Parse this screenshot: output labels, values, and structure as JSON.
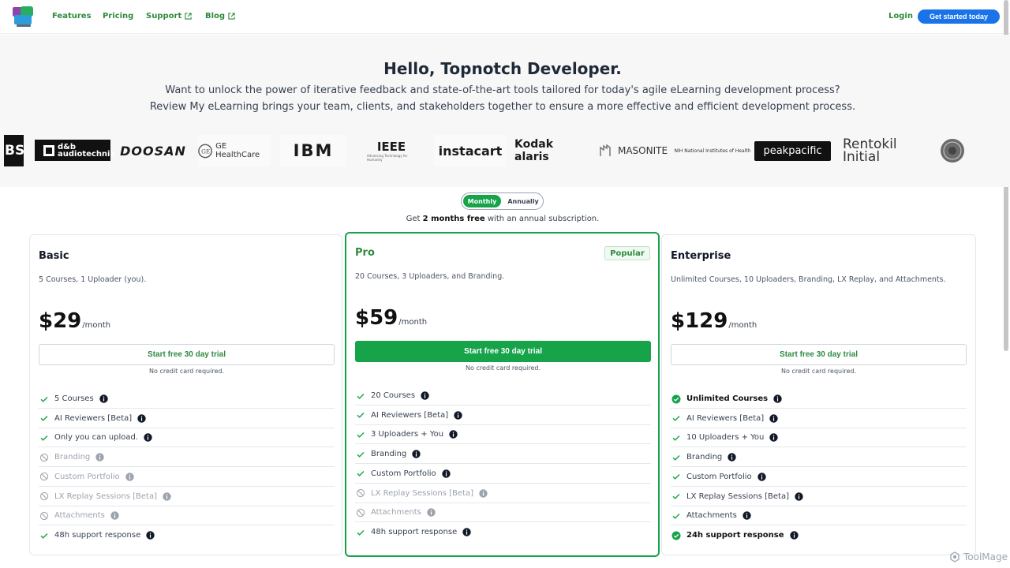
{
  "nav": {
    "links": [
      {
        "label": "Features",
        "external": false
      },
      {
        "label": "Pricing",
        "external": false
      },
      {
        "label": "Support",
        "external": true
      },
      {
        "label": "Blog",
        "external": true
      }
    ],
    "login": "Login",
    "cta": "Get started today",
    "accent": "#2f8a3f",
    "cta_color": "#1a73e8"
  },
  "hero": {
    "title": "Hello, Topnotch Developer.",
    "line1": "Want to unlock the power of iterative feedback and state-of-the-art tools tailored for today's agile eLearning development process?",
    "line2": "Review My eLearning brings your team, clients, and stakeholders together to ensure a more effective and efficient development process."
  },
  "logos": [
    "BS",
    "d&b audiotechnik",
    "DOOSAN",
    "GE HealthCare",
    "IBM",
    "IEEE",
    "instacart",
    "Kodak alaris",
    "MASONITE",
    "NIH National Institutes of Health",
    "peakpacific",
    "Rentokil Initial"
  ],
  "billing": {
    "monthly": "Monthly",
    "annually": "Annually",
    "promo_prefix": "Get ",
    "promo_bold": "2 months free",
    "promo_suffix": " with an annual subscription."
  },
  "plans": [
    {
      "name": "Basic",
      "desc": "5 Courses, 1 Uploader (you).",
      "price": "$29",
      "per": "/month",
      "cta": "Start free 30 day trial",
      "note": "No credit card required.",
      "features": [
        {
          "label": "5 Courses",
          "status": "check"
        },
        {
          "label": "AI Reviewers [Beta]",
          "status": "check"
        },
        {
          "label": "Only you can upload.",
          "status": "check"
        },
        {
          "label": "Branding",
          "status": "off"
        },
        {
          "label": "Custom Portfolio",
          "status": "off"
        },
        {
          "label": "LX Replay Sessions [Beta]",
          "status": "off"
        },
        {
          "label": "Attachments",
          "status": "off"
        },
        {
          "label": "48h support response",
          "status": "check"
        }
      ]
    },
    {
      "name": "Pro",
      "badge": "Popular",
      "desc": "20 Courses, 3 Uploaders, and Branding.",
      "price": "$59",
      "per": "/month",
      "cta": "Start free 30 day trial",
      "note": "No credit card required.",
      "features": [
        {
          "label": "20 Courses",
          "status": "check"
        },
        {
          "label": "AI Reviewers [Beta]",
          "status": "check"
        },
        {
          "label": "3 Uploaders + You",
          "status": "check"
        },
        {
          "label": "Branding",
          "status": "check"
        },
        {
          "label": "Custom Portfolio",
          "status": "check"
        },
        {
          "label": "LX Replay Sessions [Beta]",
          "status": "off"
        },
        {
          "label": "Attachments",
          "status": "off"
        },
        {
          "label": "48h support response",
          "status": "check"
        }
      ]
    },
    {
      "name": "Enterprise",
      "desc": "Unlimited Courses, 10 Uploaders, Branding, LX Replay, and Attachments.",
      "price": "$129",
      "per": "/month",
      "cta": "Start free 30 day trial",
      "note": "No credit card required.",
      "features": [
        {
          "label": "Unlimited Courses",
          "status": "highlight"
        },
        {
          "label": "AI Reviewers [Beta]",
          "status": "check"
        },
        {
          "label": "10 Uploaders + You",
          "status": "check"
        },
        {
          "label": "Branding",
          "status": "check"
        },
        {
          "label": "Custom Portfolio",
          "status": "check"
        },
        {
          "label": "LX Replay Sessions [Beta]",
          "status": "check"
        },
        {
          "label": "Attachments",
          "status": "check"
        },
        {
          "label": "24h support response",
          "status": "highlight"
        }
      ]
    }
  ],
  "watermark": "ToolMage",
  "colors": {
    "green": "#16a34a",
    "muted": "#9ca3af"
  }
}
